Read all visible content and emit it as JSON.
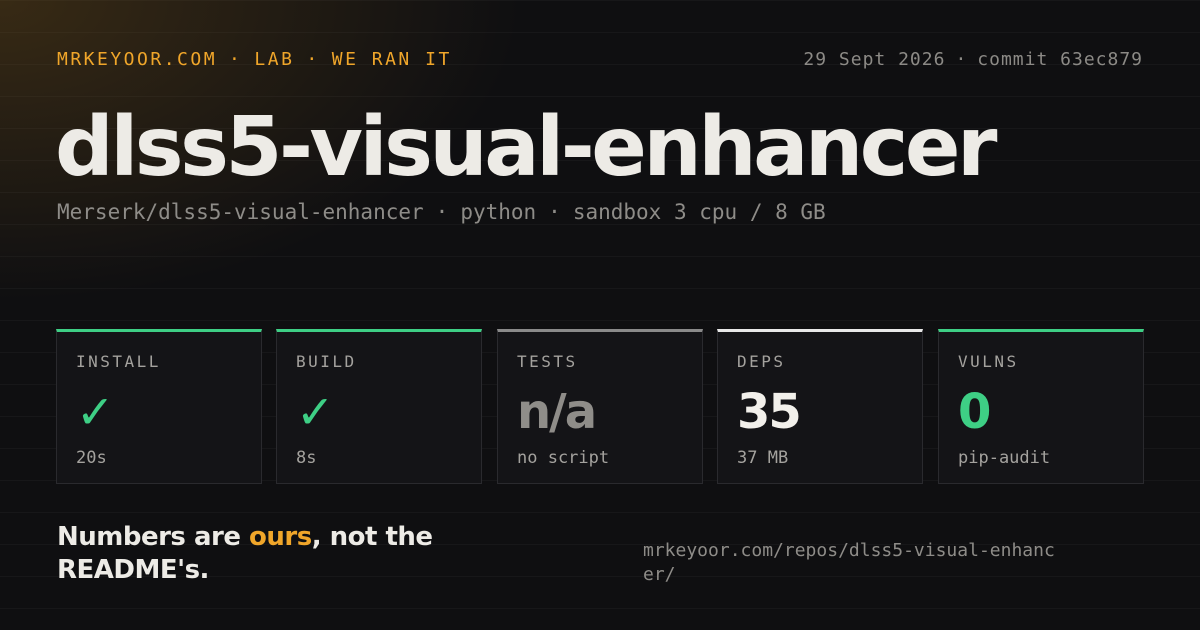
{
  "header": {
    "breadcrumb": [
      "MRKEYOOR.COM",
      "LAB",
      "WE RAN IT"
    ],
    "separator": "·",
    "date": "29 Sept 2026",
    "commit": "commit 63ec879"
  },
  "repo": {
    "name": "dlss5-visual-enhancer",
    "full_name": "Merserk/dlss5-visual-enhancer",
    "language": "python",
    "sandbox": "sandbox 3 cpu / 8 GB"
  },
  "stats": [
    {
      "label": "INSTALL",
      "value": "✓",
      "sub": "20s",
      "status": "pass",
      "accent": "#3ecf85"
    },
    {
      "label": "BUILD",
      "value": "✓",
      "sub": "8s",
      "status": "pass",
      "accent": "#3ecf85"
    },
    {
      "label": "TESTS",
      "value": "n/a",
      "sub": "no script",
      "status": "none",
      "accent": "#8a8a8a"
    },
    {
      "label": "DEPS",
      "value": "35",
      "sub": "37 MB",
      "status": "neutral",
      "accent": "#e8e8e8"
    },
    {
      "label": "VULNS",
      "value": "0",
      "sub": "pip-audit",
      "status": "pass",
      "accent": "#3ecf85"
    }
  ],
  "tagline": {
    "before": "Numbers are ",
    "highlight": "ours",
    "after": ", not the README's."
  },
  "footer": {
    "url": "mrkeyoor.com/repos/dlss5-visual-enhancer/"
  },
  "colors": {
    "brand_accent": "#f0a62a",
    "pass": "#3ecf85",
    "background": "#0f0f11"
  }
}
